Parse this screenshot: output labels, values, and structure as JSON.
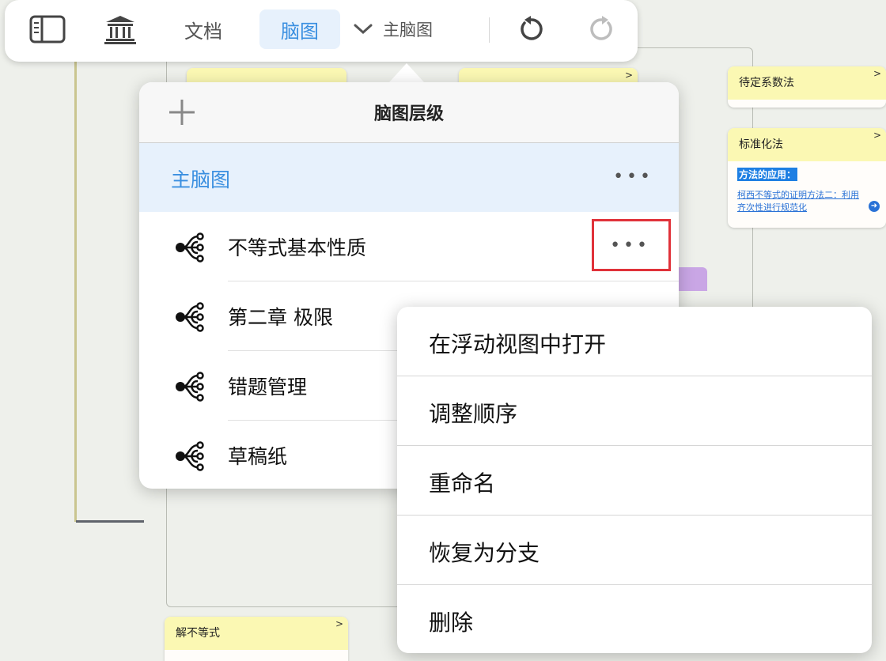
{
  "toolbar": {
    "docs_label": "文档",
    "mindmap_label": "脑图",
    "current_map_label": "主脑图",
    "icons": [
      "sidebar-icon",
      "library-icon",
      "chevron-down-icon",
      "undo-icon",
      "redo-icon"
    ]
  },
  "panel": {
    "title": "脑图层级",
    "main_item": "主脑图",
    "more_glyph": "•••",
    "items": [
      {
        "label": "不等式基本性质"
      },
      {
        "label": "第二章 极限"
      },
      {
        "label": "错题管理"
      },
      {
        "label": "草稿纸"
      }
    ]
  },
  "context_menu": {
    "items": [
      "在浮动视图中打开",
      "调整顺序",
      "重命名",
      "恢复为分支",
      "删除"
    ]
  },
  "background_cards": {
    "card_a": {
      "title": "待定系数法"
    },
    "card_b": {
      "title": "标准化法",
      "section": "方法的应用：",
      "link": "柯西不等式的证明方法二：利用齐次性进行规范化"
    },
    "card_c": {
      "title": "解不等式"
    },
    "chev": ">"
  },
  "colors": {
    "accent": "#3a8fe0",
    "card_header": "#fbf8b3",
    "highlight_box": "#e0323a"
  }
}
